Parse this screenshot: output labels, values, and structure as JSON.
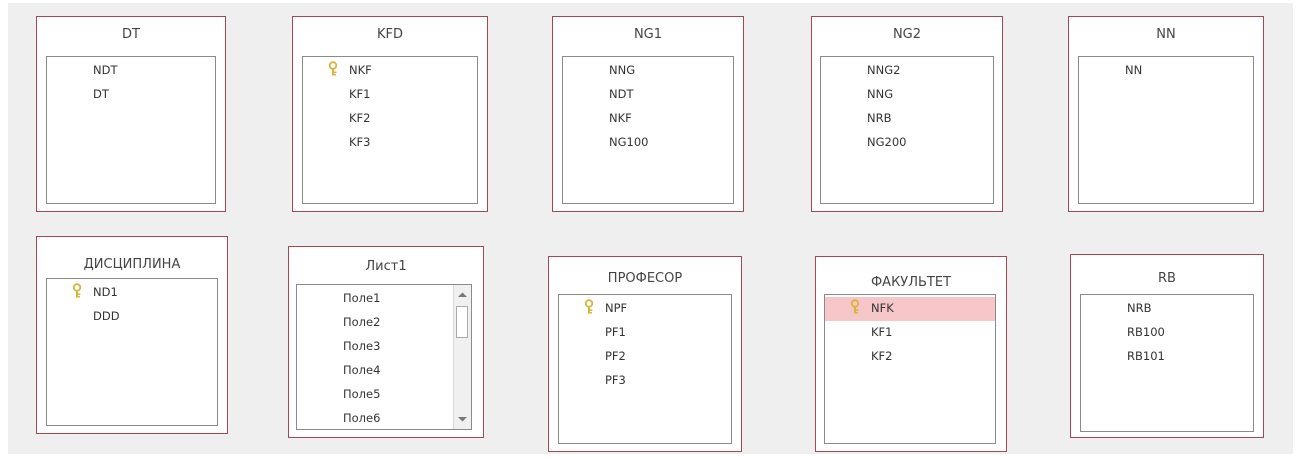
{
  "tables": [
    {
      "title": "DT",
      "fields": [
        {
          "name": "NDT",
          "key": false
        },
        {
          "name": "DT",
          "key": false
        }
      ]
    },
    {
      "title": "KFD",
      "fields": [
        {
          "name": "NKF",
          "key": true
        },
        {
          "name": "KF1",
          "key": false
        },
        {
          "name": "KF2",
          "key": false
        },
        {
          "name": "KF3",
          "key": false
        }
      ]
    },
    {
      "title": "NG1",
      "fields": [
        {
          "name": "NNG",
          "key": false
        },
        {
          "name": "NDT",
          "key": false
        },
        {
          "name": "NKF",
          "key": false
        },
        {
          "name": "NG100",
          "key": false
        }
      ]
    },
    {
      "title": "NG2",
      "fields": [
        {
          "name": "NNG2",
          "key": false
        },
        {
          "name": "NNG",
          "key": false
        },
        {
          "name": "NRB",
          "key": false
        },
        {
          "name": "NG200",
          "key": false
        }
      ]
    },
    {
      "title": "NN",
      "fields": [
        {
          "name": "NN",
          "key": false
        }
      ]
    },
    {
      "title": "ДИСЦИПЛИНА",
      "fields": [
        {
          "name": "ND1",
          "key": true
        },
        {
          "name": "DDD",
          "key": false
        }
      ]
    },
    {
      "title": "Лист1",
      "fields": [
        {
          "name": "Поле1",
          "key": false
        },
        {
          "name": "Поле2",
          "key": false
        },
        {
          "name": "Поле3",
          "key": false
        },
        {
          "name": "Поле4",
          "key": false
        },
        {
          "name": "Поле5",
          "key": false
        },
        {
          "name": "Поле6",
          "key": false
        }
      ]
    },
    {
      "title": "ПРОФЕСОР",
      "fields": [
        {
          "name": "NPF",
          "key": true
        },
        {
          "name": "PF1",
          "key": false
        },
        {
          "name": "PF2",
          "key": false
        },
        {
          "name": "PF3",
          "key": false
        }
      ]
    },
    {
      "title": "ФАКУЛЬТЕТ",
      "fields": [
        {
          "name": "NFK",
          "key": true,
          "selected": true
        },
        {
          "name": "KF1",
          "key": false
        },
        {
          "name": "KF2",
          "key": false
        }
      ]
    },
    {
      "title": "RB",
      "fields": [
        {
          "name": "NRB",
          "key": false
        },
        {
          "name": "RB100",
          "key": false
        },
        {
          "name": "RB101",
          "key": false
        }
      ]
    }
  ],
  "colors": {
    "border": "#a64755",
    "selected_row": "#f7c6c9",
    "key_icon": "#d9b43a"
  },
  "icons": {
    "key": "key-icon",
    "scroll_up": "scroll-up-arrow-icon",
    "scroll_down": "scroll-down-arrow-icon"
  }
}
